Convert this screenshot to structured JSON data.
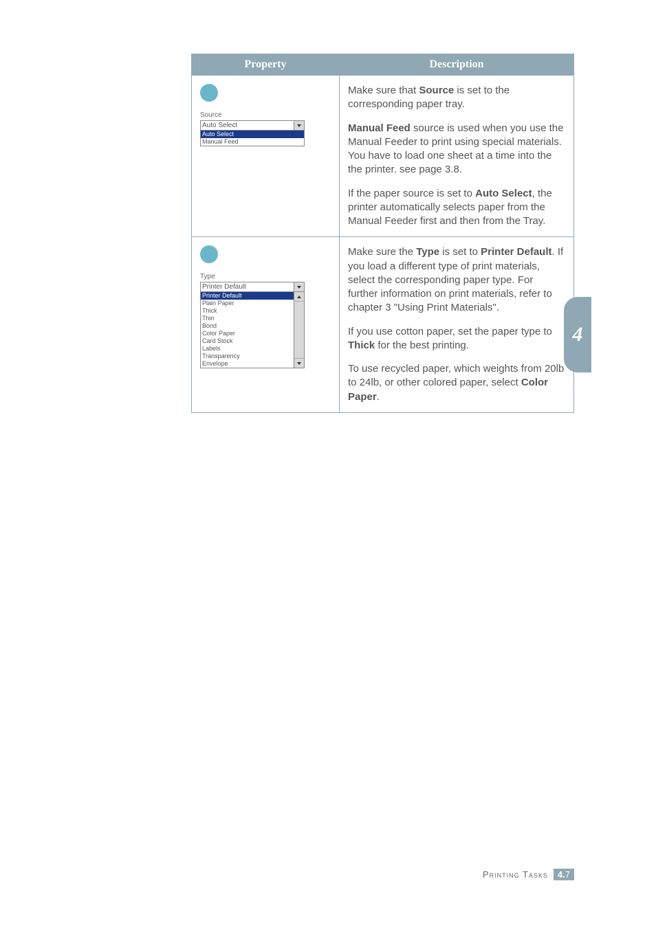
{
  "table": {
    "headers": {
      "property": "Property",
      "description": "Description"
    },
    "row1": {
      "source_label": "Source",
      "combo_value": "Auto Select",
      "list": {
        "opt0": "Auto Select",
        "opt1": "Manual Feed"
      },
      "desc": {
        "p1a": "Make sure that ",
        "p1b": "Source",
        "p1c": " is set to the corresponding paper tray.",
        "p2a": "Manual Feed",
        "p2b": " source is used when you use the Manual Feeder to print using special materials. You have to load one sheet at a time into the the printer. see page 3.8.",
        "p3a": "If the paper source is set to ",
        "p3b": "Auto Select",
        "p3c": ", the printer automatically selects paper from the Manual Feeder first and then from the Tray."
      }
    },
    "row2": {
      "type_label": "Type",
      "combo_value": "Printer Default",
      "list": {
        "opt0": "Printer Default",
        "opt1": "Plain Paper",
        "opt2": "Thick",
        "opt3": "Thin",
        "opt4": "Bond",
        "opt5": "Color Paper",
        "opt6": "Card Stock",
        "opt7": "Labels",
        "opt8": "Transparency",
        "opt9": "Envelope"
      },
      "desc": {
        "p1a": "Make sure the ",
        "p1b": "Type",
        "p1c": " is set to ",
        "p1d": "Printer Default",
        "p1e": ". If you load a different type of print materials, select the corresponding paper type. For further information on print materials, refer to chapter 3 \"Using Print Materials\".",
        "p2a": "If you use cotton paper, set the paper type to ",
        "p2b": "Thick",
        "p2c": " for the best printing.",
        "p3a": "To use recycled paper, which weights from 20lb to 24lb, or other colored paper, select ",
        "p3b": "Color Paper",
        "p3c": "."
      }
    }
  },
  "sidetab": "4",
  "footer": {
    "section": "Printing Tasks",
    "chapter": "4.",
    "page": "7"
  }
}
